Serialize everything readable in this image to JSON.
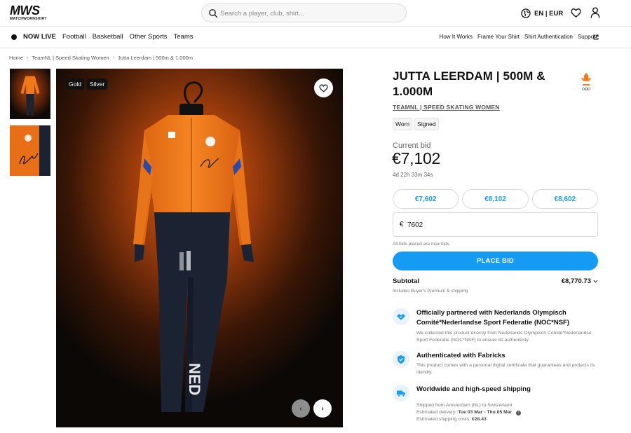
{
  "header": {
    "logo_main": "MWS",
    "logo_sub": "MATCHWORNSHIRT",
    "search_placeholder": "Search a player, club, shirt...",
    "language_currency": "EN | EUR"
  },
  "nav": {
    "live_label": "NOW LIVE",
    "items": [
      "Football",
      "Basketball",
      "Other Sports",
      "Teams"
    ],
    "right_items": [
      "How It Works",
      "Frame Your Shirt",
      "Shirt Authentication",
      "Support"
    ]
  },
  "breadcrumb": [
    "Home",
    "TeamNL | Speed Skating Women",
    "Jutta Leerdam | 500m & 1.000m"
  ],
  "gallery": {
    "tags": [
      "Gold",
      "Silver"
    ],
    "suit_text": "NED"
  },
  "product": {
    "title": "JUTTA LEERDAM | 500M & 1.000M",
    "subtitle": "TEAMNL | SPEED SKATING WOMEN",
    "badges": [
      "Worn",
      "Signed"
    ]
  },
  "bidding": {
    "current_bid_label": "Current bid",
    "current_bid": "€7,102",
    "countdown": "4d 22h 33m 34s",
    "quick_bids": [
      "€7,602",
      "€8,102",
      "€8,602"
    ],
    "currency_symbol": "€",
    "bid_input_value": "7602",
    "max_bid_note": "All bids placed are max bids",
    "place_bid_label": "PLACE BID",
    "subtotal_label": "Subtotal",
    "subtotal_value": "€8,770.73",
    "subtotal_note": "Includes Buyer's Premium & shipping"
  },
  "features": {
    "partner": {
      "title": "Officially partnered with Nederlands Olympisch Comité*Nederlandse Sport Federatie (NOC*NSF)",
      "text": "We collected this product directly from Nederlands Olympisch Comité*Nederlandse Sport Federatie (NOC*NSF) to ensure its authenticity."
    },
    "authenticated": {
      "title": "Authenticated with Fabricks",
      "text": "This product comes with a personal digital certificate that guarantees and protects its identity."
    },
    "shipping": {
      "title": "Worldwide and high-speed shipping",
      "shipped_from": "Shipped from Amsterdam (NL) to Switzerland",
      "delivery_label": "Estimated delivery:",
      "delivery_value": "Tue 03 Mar - Thu 05 Mar",
      "cost_label": "Estimated shipping costs:",
      "cost_value": "€28.43"
    }
  },
  "colors": {
    "accent": "#159bf4",
    "suit_orange": "#f07a1a",
    "suit_navy": "#1b2333",
    "background_orange": "#c4520f"
  },
  "icons": [
    "search-icon",
    "globe-icon",
    "heart-icon",
    "user-icon",
    "external-link-icon",
    "chevron-down-icon",
    "handshake-icon",
    "shield-check-icon",
    "truck-icon",
    "info-icon"
  ]
}
